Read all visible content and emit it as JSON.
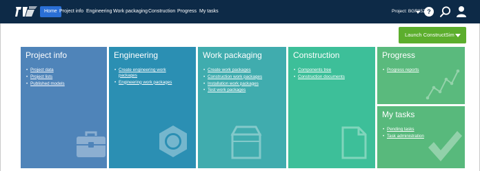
{
  "nav": {
    "items": [
      {
        "label": "Home",
        "active": true
      },
      {
        "label": "Project info"
      },
      {
        "label": "Engineering"
      },
      {
        "label": "Work packaging"
      },
      {
        "label": "Construction"
      },
      {
        "label": "Progress"
      },
      {
        "label": "My tasks"
      }
    ],
    "project_label": "Project: BGR852",
    "help_label": "?"
  },
  "launch": {
    "label": "Launch ConstructSim"
  },
  "tiles": {
    "project_info": {
      "title": "Project info",
      "links": [
        "Project data",
        "Project lists",
        "Published models"
      ]
    },
    "engineering": {
      "title": "Engineering",
      "links": [
        "Create engineering work packages",
        "Engineering work packages"
      ]
    },
    "work_packaging": {
      "title": "Work packaging",
      "links": [
        "Create work packages",
        "Construction work packages",
        "Installation work packages",
        "Test work packages"
      ]
    },
    "construction": {
      "title": "Construction",
      "links": [
        "Components tree",
        "Construction documents"
      ]
    },
    "progress": {
      "title": "Progress",
      "links": [
        "Progress reports"
      ]
    },
    "my_tasks": {
      "title": "My tasks",
      "links": [
        "Pending tasks",
        "Task administration"
      ]
    }
  },
  "colors": {
    "navbar": "#0d2a47",
    "active_tab": "#2a6fd6",
    "launch": "#5cae2d",
    "project_info": "#4f84b9",
    "engineering": "#2b8fb3",
    "work_packaging": "#40acae",
    "construction": "#3dbf99",
    "progress": "#5aba7d",
    "my_tasks": "#58b97c"
  },
  "icons": [
    "app-logo-icon",
    "chevron-down-icon",
    "help-icon",
    "search-icon",
    "user-icon",
    "briefcase-icon",
    "hex-nut-icon",
    "box-icon",
    "document-icon",
    "line-chart-icon",
    "checkmark-icon"
  ]
}
